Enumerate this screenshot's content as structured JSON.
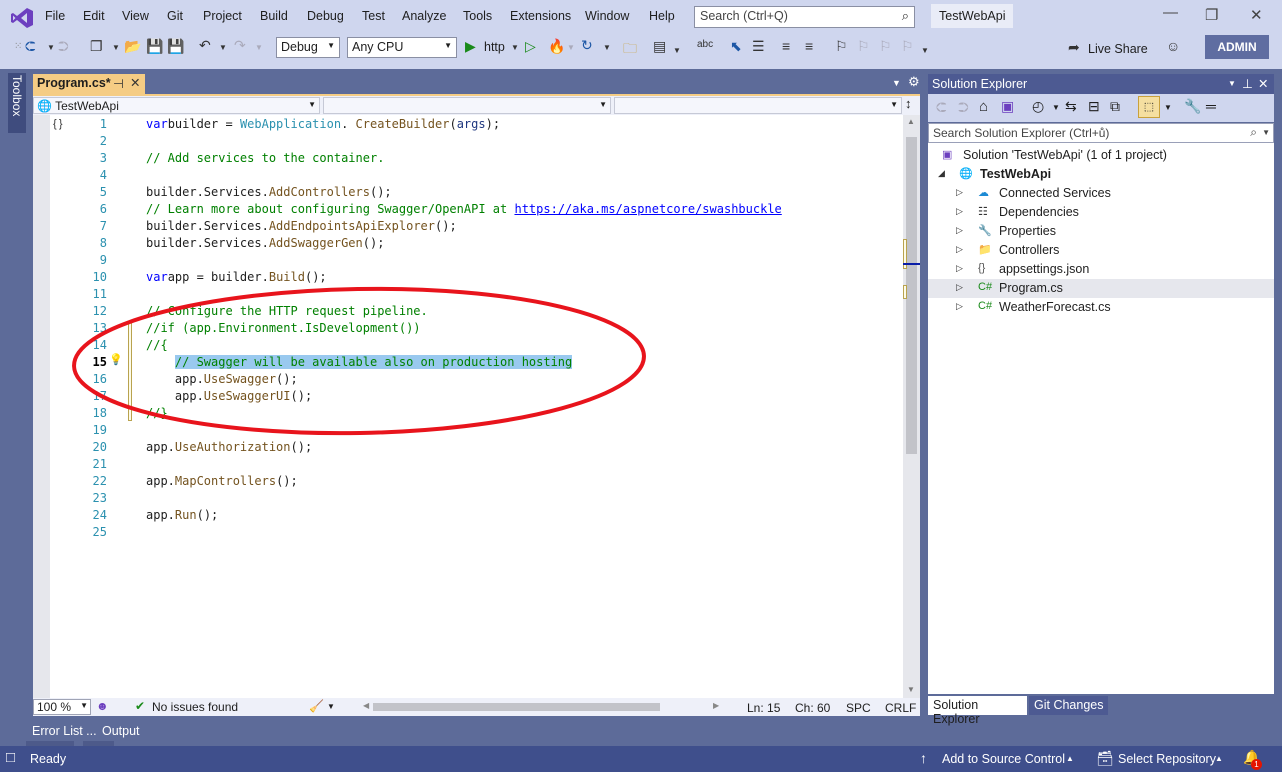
{
  "window": {
    "solution_name": "TestWebApi",
    "search_placeholder": "Search (Ctrl+Q)",
    "account_label": "ADMIN",
    "live_share_label": "Live Share"
  },
  "menu": [
    "File",
    "Edit",
    "View",
    "Git",
    "Project",
    "Build",
    "Debug",
    "Test",
    "Analyze",
    "Tools",
    "Extensions",
    "Window",
    "Help"
  ],
  "toolbar": {
    "configuration": "Debug",
    "platform": "Any CPU",
    "run_target": "http"
  },
  "editor": {
    "tab_label": "Program.cs*",
    "nav_project": "TestWebApi",
    "nav_type": "",
    "nav_member": "",
    "lines": [
      {
        "n": "1",
        "tokens": [
          [
            "kw",
            "var"
          ],
          [
            "",
            "builder = "
          ],
          [
            "ty",
            "WebApplication"
          ],
          [
            "",
            ". "
          ],
          [
            "mt",
            "CreateBuilder"
          ],
          [
            "",
            "("
          ],
          [
            "id",
            "args"
          ],
          [
            "",
            ");"
          ]
        ]
      },
      {
        "n": "2",
        "tokens": []
      },
      {
        "n": "3",
        "tokens": [
          [
            "cm",
            "// Add services to the container."
          ]
        ]
      },
      {
        "n": "4",
        "tokens": []
      },
      {
        "n": "5",
        "tokens": [
          [
            "",
            "builder.Services."
          ],
          [
            "mt",
            "AddControllers"
          ],
          [
            "",
            "();"
          ]
        ]
      },
      {
        "n": "6",
        "tokens": [
          [
            "cm",
            "// Learn more about configuring Swagger/OpenAPI at "
          ],
          [
            "lk",
            "https://aka.ms/aspnetcore/swashbuckle"
          ]
        ]
      },
      {
        "n": "7",
        "tokens": [
          [
            "",
            "builder.Services."
          ],
          [
            "mt",
            "AddEndpointsApiExplorer"
          ],
          [
            "",
            "();"
          ]
        ]
      },
      {
        "n": "8",
        "tokens": [
          [
            "",
            "builder.Services."
          ],
          [
            "mt",
            "AddSwaggerGen"
          ],
          [
            "",
            "();"
          ]
        ]
      },
      {
        "n": "9",
        "tokens": []
      },
      {
        "n": "10",
        "tokens": [
          [
            "kw",
            "var"
          ],
          [
            "",
            "app = builder."
          ],
          [
            "mt",
            "Build"
          ],
          [
            "",
            "();"
          ]
        ]
      },
      {
        "n": "11",
        "tokens": []
      },
      {
        "n": "12",
        "tokens": [
          [
            "cm",
            "// Configure the HTTP request pipeline."
          ]
        ]
      },
      {
        "n": "13",
        "tokens": [
          [
            "cm",
            "//if (app.Environment.IsDevelopment())"
          ]
        ]
      },
      {
        "n": "14",
        "tokens": [
          [
            "cm",
            "//{"
          ]
        ]
      },
      {
        "n": "15",
        "tokens": [
          [
            "",
            "    "
          ],
          [
            "cm sel",
            "// Swagger will be available also on production hosting"
          ]
        ]
      },
      {
        "n": "16",
        "tokens": [
          [
            "",
            "    app."
          ],
          [
            "mt",
            "UseSwagger"
          ],
          [
            "",
            "();"
          ]
        ]
      },
      {
        "n": "17",
        "tokens": [
          [
            "",
            "    app."
          ],
          [
            "mt",
            "UseSwaggerUI"
          ],
          [
            "",
            "();"
          ]
        ]
      },
      {
        "n": "18",
        "tokens": [
          [
            "cm",
            "//}"
          ]
        ]
      },
      {
        "n": "19",
        "tokens": []
      },
      {
        "n": "20",
        "tokens": [
          [
            "",
            "app."
          ],
          [
            "mt",
            "UseAuthorization"
          ],
          [
            "",
            "();"
          ]
        ]
      },
      {
        "n": "21",
        "tokens": []
      },
      {
        "n": "22",
        "tokens": [
          [
            "",
            "app."
          ],
          [
            "mt",
            "MapControllers"
          ],
          [
            "",
            "();"
          ]
        ]
      },
      {
        "n": "23",
        "tokens": []
      },
      {
        "n": "24",
        "tokens": [
          [
            "",
            "app."
          ],
          [
            "mt",
            "Run"
          ],
          [
            "",
            "();"
          ]
        ]
      },
      {
        "n": "25",
        "tokens": []
      }
    ],
    "current_line": "15",
    "zoom": "100 %",
    "issues": "No issues found",
    "cursor_line": "Ln: 15",
    "cursor_char": "Ch: 60",
    "whitespace": "SPC",
    "line_ending": "CRLF"
  },
  "left_strip": {
    "toolbox_label": "Toolbox"
  },
  "solution_explorer": {
    "title": "Solution Explorer",
    "search_placeholder": "Search Solution Explorer (Ctrl+ů)",
    "solution_node": "Solution 'TestWebApi' (1 of 1 project)",
    "project_node": "TestWebApi",
    "items": [
      {
        "label": "Connected Services",
        "icon": "cloud-plug-icon"
      },
      {
        "label": "Dependencies",
        "icon": "dependencies-icon"
      },
      {
        "label": "Properties",
        "icon": "wrench-folder-icon"
      },
      {
        "label": "Controllers",
        "icon": "folder-icon"
      },
      {
        "label": "appsettings.json",
        "icon": "json-file-icon"
      },
      {
        "label": "Program.cs",
        "icon": "csharp-file-icon"
      },
      {
        "label": "WeatherForecast.cs",
        "icon": "csharp-file-icon"
      }
    ],
    "selected_item": "Program.cs",
    "tabs": [
      "Solution Explorer",
      "Git Changes"
    ]
  },
  "bottom_panel": {
    "tabs": [
      "Error List ...",
      "Output"
    ]
  },
  "statusbar": {
    "state": "Ready",
    "source_control": "Add to Source Control",
    "repository": "Select Repository",
    "notifications": "1"
  },
  "annotation": {
    "color": "#e8141c",
    "shape": "ellipse"
  }
}
